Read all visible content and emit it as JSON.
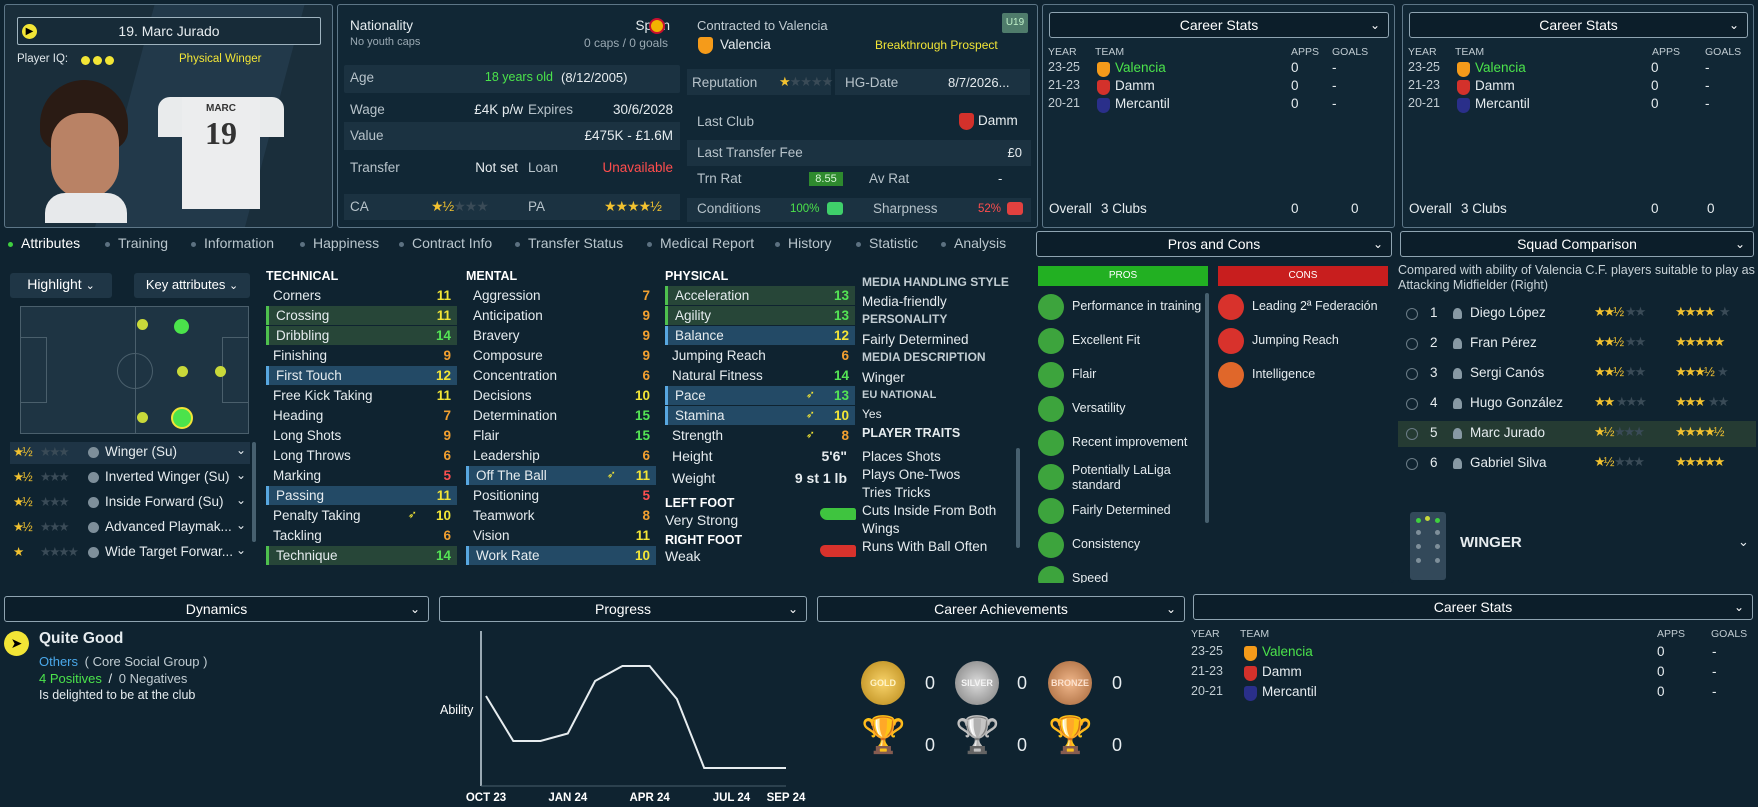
{
  "player": {
    "name": "19. Marc Jurado",
    "iq_label": "Player IQ:",
    "role_tag": "Physical Winger",
    "shirt_name": "MARC",
    "shirt_number": "19"
  },
  "info": {
    "nationality_label": "Nationality",
    "nationality": "Spain",
    "youth_caps": "No youth caps",
    "caps": "0 caps / 0 goals",
    "contract_label": "Contracted to Valencia",
    "club": "Valencia",
    "u19": "U19",
    "prospect": "Breakthrough Prospect",
    "age_label": "Age",
    "age": "18 years old",
    "dob": "(8/12/2005)",
    "reputation_label": "Reputation",
    "reputation": "1 of 5",
    "hg_label": "HG-Date",
    "hg_value": "8/7/2026...",
    "wage_label": "Wage",
    "wage": "£4K p/w",
    "expires_label": "Expires",
    "expires": "30/6/2028",
    "lastclub_label": "Last Club",
    "lastclub": "Damm",
    "value_label": "Value",
    "value": "£475K - £1.6M",
    "ltf_label": "Last Transfer Fee",
    "ltf": "£0",
    "transfer_label": "Transfer",
    "transfer": "Not set",
    "loan_label": "Loan",
    "loan": "Unavailable",
    "trnrat_label": "Trn Rat",
    "trnrat": "8.55",
    "avrat_label": "Av Rat",
    "avrat": "-",
    "ca_label": "CA",
    "ca": "1.5 of 5",
    "pa_label": "PA",
    "pa": "4.5 of 5",
    "conditions_label": "Conditions",
    "conditions": "100%",
    "sharpness_label": "Sharpness",
    "sharpness": "52%"
  },
  "career_stats": {
    "title": "Career Stats",
    "headers": [
      "YEAR",
      "TEAM",
      "APPS",
      "GOALS"
    ],
    "rows": [
      {
        "year": "23-25",
        "team": "Valencia",
        "apps": "0",
        "goals": "-"
      },
      {
        "year": "21-23",
        "team": "Damm",
        "apps": "0",
        "goals": "-"
      },
      {
        "year": "20-21",
        "team": "Mercantil",
        "apps": "0",
        "goals": "-"
      }
    ],
    "overall_label": "Overall",
    "overall_clubs": "3 Clubs",
    "overall_apps": "0",
    "overall_goals": "0"
  },
  "tabs": [
    "Attributes",
    "Training",
    "Information",
    "Happiness",
    "Contract Info",
    "Transfer Status",
    "Medical Report",
    "History",
    "Statistic",
    "Analysis"
  ],
  "controls": {
    "highlight": "Highlight",
    "key_attributes": "Key attributes"
  },
  "roles": [
    {
      "name": "Winger (Su)",
      "stars": "1.5"
    },
    {
      "name": "Inverted Winger (Su)",
      "stars": "1.5"
    },
    {
      "name": "Inside Forward (Su)",
      "stars": "1.5"
    },
    {
      "name": "Advanced Playmak...",
      "stars": "1.5"
    },
    {
      "name": "Wide Target Forwar...",
      "stars": "1"
    }
  ],
  "technical": {
    "title": "TECHNICAL",
    "items": [
      {
        "n": "Corners",
        "v": "11"
      },
      {
        "n": "Crossing",
        "v": "11"
      },
      {
        "n": "Dribbling",
        "v": "14"
      },
      {
        "n": "Finishing",
        "v": "9"
      },
      {
        "n": "First Touch",
        "v": "12"
      },
      {
        "n": "Free Kick Taking",
        "v": "11"
      },
      {
        "n": "Heading",
        "v": "7"
      },
      {
        "n": "Long Shots",
        "v": "9"
      },
      {
        "n": "Long Throws",
        "v": "6"
      },
      {
        "n": "Marking",
        "v": "5"
      },
      {
        "n": "Passing",
        "v": "11"
      },
      {
        "n": "Penalty Taking",
        "v": "10"
      },
      {
        "n": "Tackling",
        "v": "6"
      },
      {
        "n": "Technique",
        "v": "14"
      }
    ]
  },
  "mental": {
    "title": "MENTAL",
    "items": [
      {
        "n": "Aggression",
        "v": "7"
      },
      {
        "n": "Anticipation",
        "v": "9"
      },
      {
        "n": "Bravery",
        "v": "9"
      },
      {
        "n": "Composure",
        "v": "9"
      },
      {
        "n": "Concentration",
        "v": "6"
      },
      {
        "n": "Decisions",
        "v": "10"
      },
      {
        "n": "Determination",
        "v": "15"
      },
      {
        "n": "Flair",
        "v": "15"
      },
      {
        "n": "Leadership",
        "v": "6"
      },
      {
        "n": "Off The Ball",
        "v": "11"
      },
      {
        "n": "Positioning",
        "v": "5"
      },
      {
        "n": "Teamwork",
        "v": "8"
      },
      {
        "n": "Vision",
        "v": "11"
      },
      {
        "n": "Work Rate",
        "v": "10"
      }
    ]
  },
  "physical": {
    "title": "PHYSICAL",
    "items": [
      {
        "n": "Acceleration",
        "v": "13"
      },
      {
        "n": "Agility",
        "v": "13"
      },
      {
        "n": "Balance",
        "v": "12"
      },
      {
        "n": "Jumping Reach",
        "v": "6"
      },
      {
        "n": "Natural Fitness",
        "v": "14"
      },
      {
        "n": "Pace",
        "v": "13"
      },
      {
        "n": "Stamina",
        "v": "10"
      },
      {
        "n": "Strength",
        "v": "8"
      }
    ]
  },
  "body": {
    "height_label": "Height",
    "height": "5'6\"",
    "weight_label": "Weight",
    "weight": "9 st 1 lb",
    "left_foot_label": "LEFT FOOT",
    "left_foot": "Very Strong",
    "right_foot_label": "RIGHT FOOT",
    "right_foot": "Weak"
  },
  "media": {
    "style_label": "MEDIA HANDLING STYLE",
    "style": "Media-friendly",
    "personality_label": "PERSONALITY",
    "personality": "Fairly Determined",
    "desc_label": "MEDIA DESCRIPTION",
    "desc": "Winger",
    "eu_label": "EU NATIONAL",
    "eu": "Yes",
    "traits_label": "PLAYER TRAITS",
    "traits": [
      "Places Shots",
      "Plays One-Twos",
      "Tries Tricks",
      "Cuts Inside From Both Wings",
      "Runs With Ball Often"
    ]
  },
  "proscons": {
    "title": "Pros and Cons",
    "pros_label": "PROS",
    "cons_label": "CONS",
    "pros": [
      "Performance in training",
      "Excellent Fit",
      "Flair",
      "Versatility",
      "Recent improvement",
      "Potentially LaLiga standard",
      "Fairly Determined",
      "Consistency",
      "Speed"
    ],
    "cons": [
      "Leading 2ª Federación",
      "Jumping Reach",
      "Intelligence"
    ]
  },
  "squad": {
    "title": "Squad Comparison",
    "desc": "Compared with ability of Valencia C.F. players suitable to play as Attacking Midfielder (Right)",
    "players": [
      {
        "rank": "1",
        "name": "Diego López",
        "ca": "2.5",
        "pa": "4"
      },
      {
        "rank": "2",
        "name": "Fran Pérez",
        "ca": "2.5",
        "pa": "5"
      },
      {
        "rank": "3",
        "name": "Sergi Canós",
        "ca": "2.5",
        "pa": "3.5"
      },
      {
        "rank": "4",
        "name": "Hugo González",
        "ca": "2",
        "pa": "3"
      },
      {
        "rank": "5",
        "name": "Marc Jurado",
        "ca": "1.5",
        "pa": "4.5"
      },
      {
        "rank": "6",
        "name": "Gabriel Silva",
        "ca": "1.5",
        "pa": "5"
      }
    ],
    "position": "WINGER"
  },
  "dynamics": {
    "title": "Dynamics",
    "status": "Quite Good",
    "group": "Others",
    "group_desc": "( Core Social Group )",
    "positives": "4 Positives",
    "sep": "/",
    "negatives": "0 Negatives",
    "note": "Is delighted to be at the club"
  },
  "progress": {
    "title": "Progress",
    "ylabel": "Ability",
    "xticks": [
      "OCT 23",
      "JAN 24",
      "APR 24",
      "JUL 24",
      "SEP 24"
    ]
  },
  "chart_data": {
    "type": "line",
    "title": "Progress",
    "ylabel": "Ability",
    "xlabel": "",
    "x": [
      "OCT 23",
      "NOV 23",
      "DEC 23",
      "JAN 24",
      "FEB 24",
      "MAR 24",
      "APR 24",
      "MAY 24",
      "JUN 24",
      "JUL 24",
      "AUG 24",
      "SEP 24"
    ],
    "series": [
      {
        "values": [
          60,
          30,
          30,
          35,
          70,
          80,
          80,
          58,
          12,
          12,
          12,
          12
        ]
      }
    ],
    "ylim": [
      0,
      100
    ]
  },
  "achievements": {
    "title": "Career Achievements",
    "gold": "0",
    "silver": "0",
    "bronze": "0",
    "trophy1": "0",
    "trophy2": "0",
    "trophy3": "0",
    "gold_label": "GOLD",
    "silver_label": "SILVER",
    "bronze_label": "BRONZE"
  },
  "colors": {
    "accent_green": "#4be34b",
    "panel": "#112735",
    "border": "#5d7687"
  }
}
